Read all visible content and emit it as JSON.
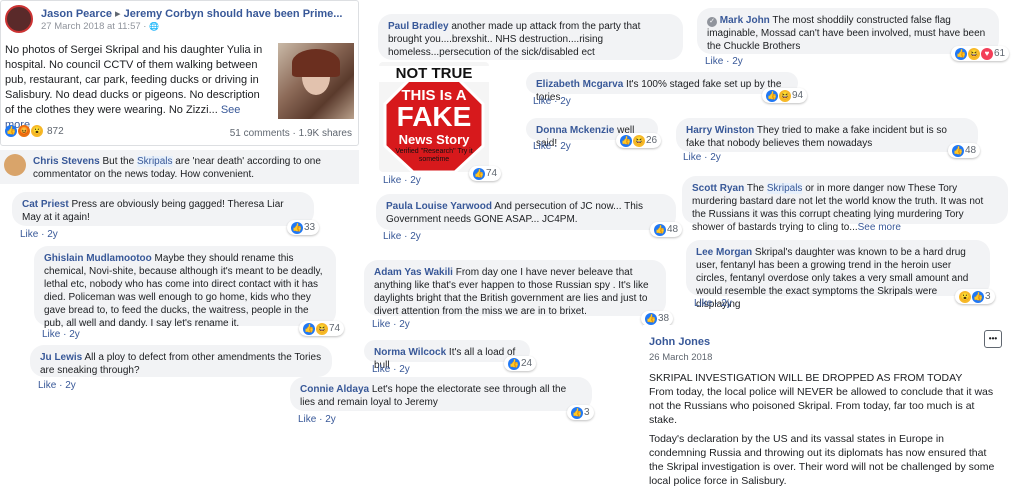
{
  "post": {
    "author": "Jason Pearce",
    "arrow": "▸",
    "target": "Jeremy Corbyn should have been Prime...",
    "date": "27 March 2018 at 11:57 · ",
    "globe": "🌐",
    "body": "No photos of Sergei Skripal and his daughter Yulia in hospital. No council CCTV of them walking between pub, restaurant, car park, feeding ducks or driving in Salisbury. No dead ducks or pigeons. No description of the clothes they were wearing. No Zizzi... ",
    "see_more": "See more",
    "reaction_count": "872",
    "comments_shares": "51 comments · 1.9K shares"
  },
  "comments": [
    {
      "id": "chris",
      "name": "Chris Stevens",
      "pre": " But the ",
      "hl": "Skripals",
      "post": " are 'near death' according to one commentator on the news today. How convenient."
    },
    {
      "id": "cat",
      "name": "Cat Priest",
      "text": " Press are obviously being gagged! Theresa Liar May at it again!",
      "meta": "Like · 2y",
      "count": "33"
    },
    {
      "id": "ghislain",
      "name": "Ghislain Mudlamootoo",
      "text": " Maybe they should rename this chemical, Novi-shite, because although it's meant to be deadly, lethal etc, nobody who has come into direct contact with it has died. Policeman was well enough to go home, kids who they gave bread to, to feed the ducks, the waitress, people in the pub, all well and dandy. I say let's rename it.",
      "meta": "Like · 2y",
      "count": "74"
    },
    {
      "id": "ju",
      "name": "Ju Lewis",
      "text": " All a ploy to defect from other amendments the Tories are sneaking through?",
      "meta": "Like · 2y"
    },
    {
      "id": "paul",
      "name": "Paul Bradley",
      "text": " another made up attack from the party that brought you....brexshit.. NHS destruction....rising homeless...persecution of the sick/disabled ect"
    },
    {
      "id": "image",
      "meta": "Like · 2y",
      "count": "74"
    },
    {
      "id": "paula",
      "name": "Paula Louise Yarwood",
      "text": " And persecution of JC now... This Government needs GONE ASAP... JC4PM.",
      "meta": "Like · 2y",
      "count": "48"
    },
    {
      "id": "adam",
      "name": "Adam Yas Wakili",
      "text": " From day one I have never beleave that anything like that's ever happen to those Russian spy . It's like daylights bright that the British government are lies and just to divert attention from the miss we are in to brixet.",
      "meta": "Like · 2y",
      "count": "38"
    },
    {
      "id": "norma",
      "name": "Norma Wilcock",
      "text": " It's all a load of bull",
      "meta": "Like · 2y",
      "count": "24"
    },
    {
      "id": "connie",
      "name": "Connie Aldaya",
      "text": " Let's hope the electorate see through all the lies and remain loyal to Jeremy",
      "meta": "Like · 2y",
      "count": "3"
    },
    {
      "id": "mark",
      "name": "Mark John",
      "text": " The most shoddily constructed false flag imaginable, Mossad can't have been involved, must have been the Chuckle Brothers",
      "meta": "Like · 2y",
      "count": "61"
    },
    {
      "id": "elizabeth",
      "name": "Elizabeth Mcgarva",
      "text": " It's 100% staged fake set up by the tories",
      "meta": "Like · 2y",
      "count": "94"
    },
    {
      "id": "donna",
      "name": "Donna Mckenzie",
      "text": " well said!",
      "meta": "Like · 2y",
      "count": "26"
    },
    {
      "id": "harry",
      "name": "Harry Winston",
      "text": " They tried to make a fake incident but is so fake that nobody believes them nowadays",
      "meta": "Like · 2y",
      "count": "48"
    },
    {
      "id": "scott",
      "name": "Scott Ryan",
      "pre": " The ",
      "hl": "Skripals",
      "post": " or in more danger now These Tory murdering bastard dare not let the world know the truth. It was not the Russians it was this corrupt cheating lying murdering Tory shower of bastards trying to cling to...",
      "see_more": "See more"
    },
    {
      "id": "lee",
      "name": "Lee Morgan",
      "text": " Skripal's daughter was known to be a hard drug user, fentanyl has been a growing trend in the heroin user circles, fentanyl overdose only takes a very small amount and would resemble the exact symptoms the Skripals were displaying",
      "meta": "Like · 2y",
      "count": "3"
    }
  ],
  "fake_news_image": {
    "top": "NOT TRUE",
    "line1": "THIS Is A",
    "line2": "FAKE",
    "line3": "News Story",
    "small": "Verified \"Research\" Try it sometime"
  },
  "john_post": {
    "author": "John Jones",
    "date": "26 March 2018",
    "menu": "•••",
    "headline": "SKRIPAL INVESTIGATION WILL BE DROPPED AS FROM TODAY",
    "para1": "From today, the local police will NEVER be allowed to conclude that it was not the Russians who poisoned Skripal. From today, far too much is at stake.",
    "para2": "Today's declaration by the US and its vassal states in Europe in condemning Russia and throwing out its diplomats has now ensured that the Skripal investigation is over. Their word will not be challenged by some local police force in Salisbury."
  },
  "colors": {
    "link": "#385898",
    "bubble": "#f2f3f5",
    "like_blue": "#2078f4"
  }
}
